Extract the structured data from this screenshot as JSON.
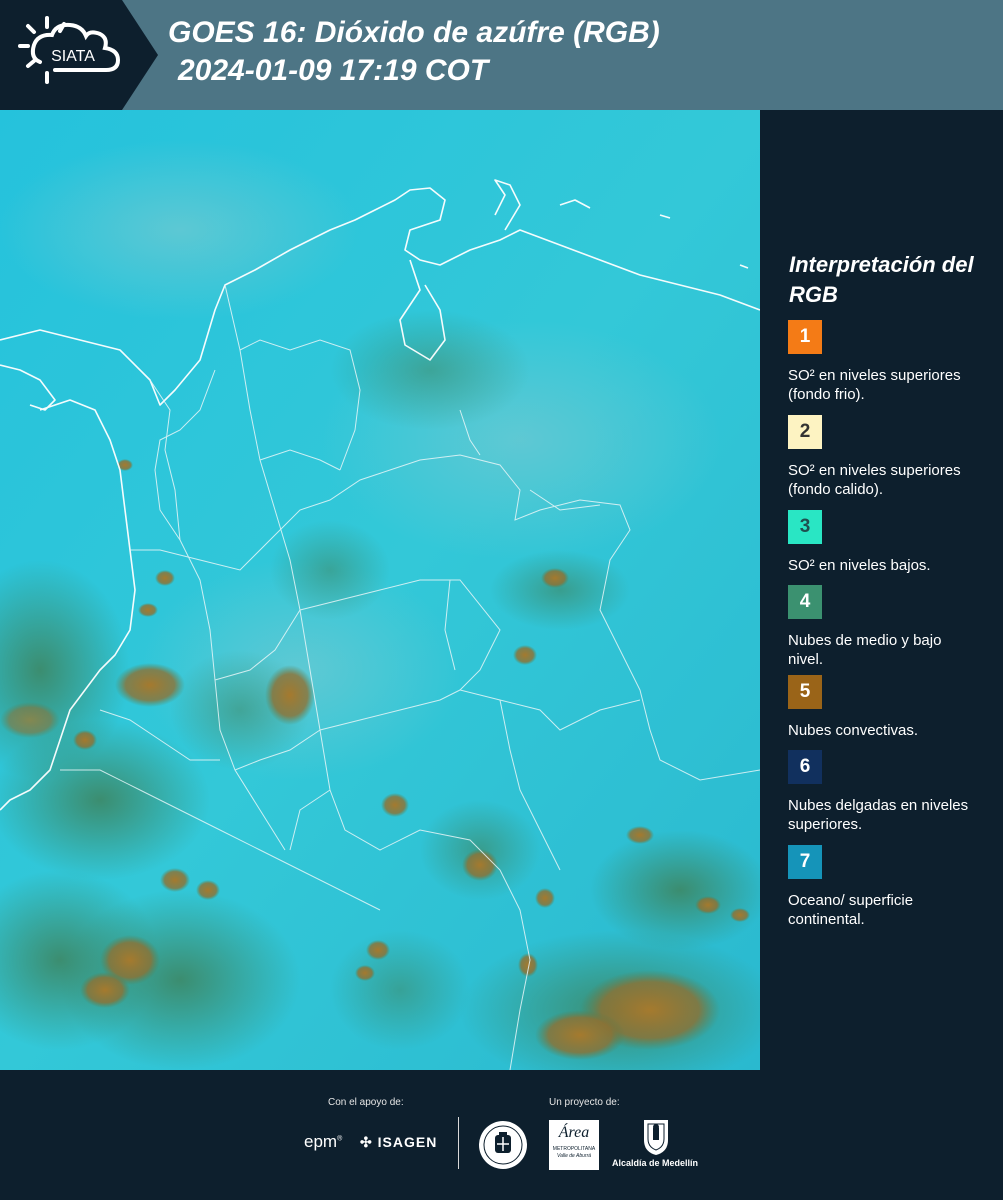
{
  "header": {
    "logo_text": "SIATA",
    "title_line1": "GOES 16: Dióxido de azúfre (RGB)",
    "title_line2": "2024-01-09 17:19 COT"
  },
  "legend": {
    "title": "Interpretación del RGB",
    "items": [
      {
        "number": "1",
        "label": "SO² en niveles superiores (fondo frio).",
        "color": "#f47b16",
        "text_color": "#ffffff"
      },
      {
        "number": "2",
        "label": "SO² en niveles superiores (fondo calido).",
        "color": "#fdf3c2",
        "text_color": "#333333"
      },
      {
        "number": "3",
        "label": "SO² en niveles bajos.",
        "color": "#29e6c4",
        "text_color": "#1f4f4f"
      },
      {
        "number": "4",
        "label": "Nubes de medio y bajo nivel.",
        "color": "#3b9170",
        "text_color": "#ffffff"
      },
      {
        "number": "5",
        "label": "Nubes convectivas.",
        "color": "#9a6418",
        "text_color": "#ffffff"
      },
      {
        "number": "6",
        "label": "Nubes delgadas en niveles superiores.",
        "color": "#11305e",
        "text_color": "#ffffff"
      },
      {
        "number": "7",
        "label": "Oceano/ superficie continental.",
        "color": "#1594b9",
        "text_color": "#ffffff"
      }
    ]
  },
  "footer": {
    "support_label": "Con el apoyo de:",
    "project_label": "Un proyecto de:",
    "sponsor_epm": "epm",
    "sponsor_isagen": "ISAGEN",
    "partner_area_name": "Área",
    "partner_area_sub": "METROPOLITANA",
    "partner_area_sub2": "Valle de Aburrá",
    "partner_alcaldia": "Alcaldía de Medellín"
  }
}
